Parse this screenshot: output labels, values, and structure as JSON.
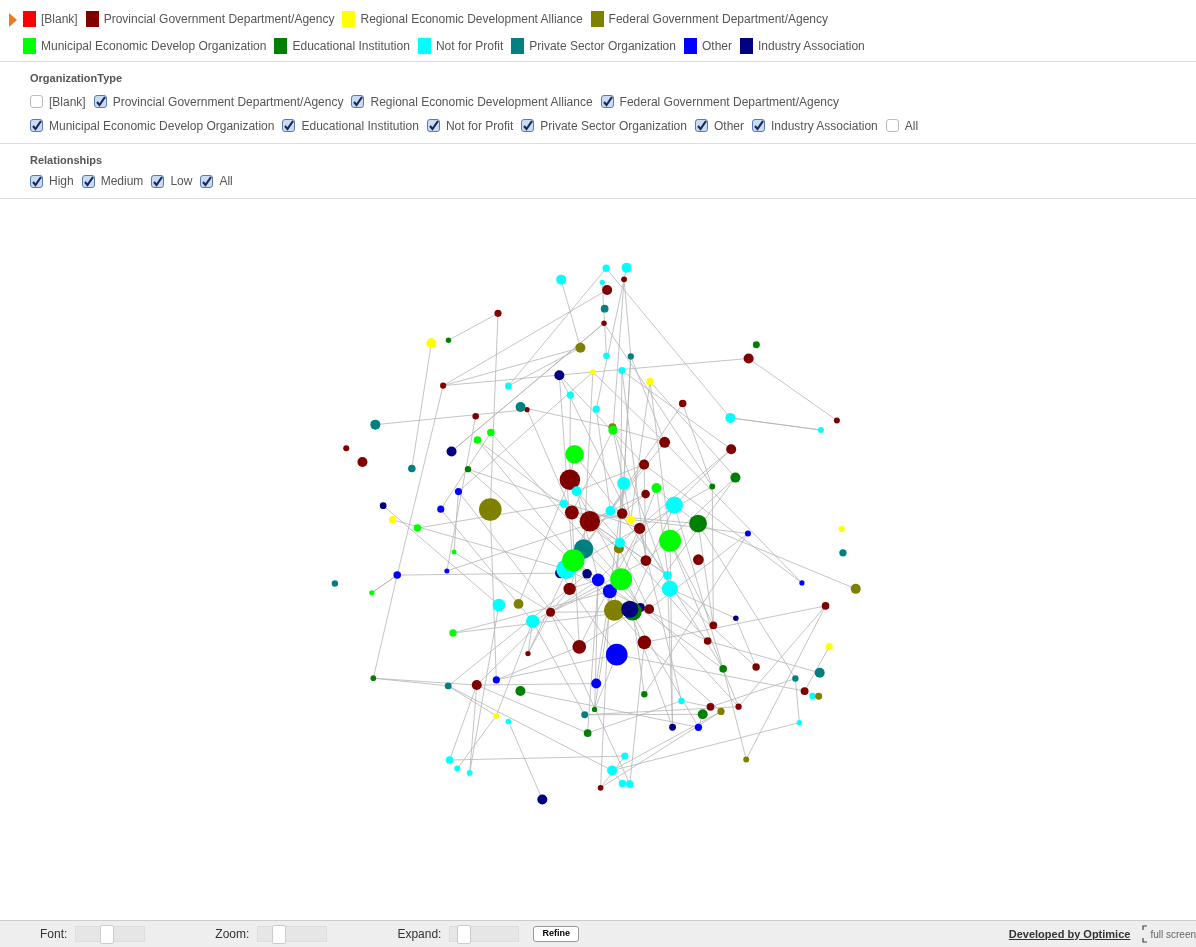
{
  "legend": [
    {
      "label": "[Blank]",
      "color": "#ff0000"
    },
    {
      "label": "Provincial Government Department/Agency",
      "color": "#800000"
    },
    {
      "label": "Regional Economic Development Alliance",
      "color": "#ffff00"
    },
    {
      "label": "Federal Government Department/Agency",
      "color": "#808000"
    },
    {
      "label": "Municipal Economic Develop Organization",
      "color": "#00ff00"
    },
    {
      "label": "Educational Institution",
      "color": "#008000"
    },
    {
      "label": "Not for Profit",
      "color": "#00ffff"
    },
    {
      "label": "Private Sector Organization",
      "color": "#008080"
    },
    {
      "label": "Other",
      "color": "#0000ff"
    },
    {
      "label": "Industry Association",
      "color": "#000080"
    }
  ],
  "organization_type": {
    "title": "OrganizationType",
    "options": [
      {
        "label": "[Blank]",
        "checked": false
      },
      {
        "label": "Provincial Government Department/Agency",
        "checked": true
      },
      {
        "label": "Regional Economic Development Alliance",
        "checked": true
      },
      {
        "label": "Federal Government Department/Agency",
        "checked": true
      },
      {
        "label": "Municipal Economic Develop Organization",
        "checked": true
      },
      {
        "label": "Educational Institution",
        "checked": true
      },
      {
        "label": "Not for Profit",
        "checked": true
      },
      {
        "label": "Private Sector Organization",
        "checked": true
      },
      {
        "label": "Other",
        "checked": true
      },
      {
        "label": "Industry Association",
        "checked": true
      },
      {
        "label": "All",
        "checked": false
      }
    ]
  },
  "relationships": {
    "title": "Relationships",
    "options": [
      {
        "label": "High",
        "checked": true
      },
      {
        "label": "Medium",
        "checked": true
      },
      {
        "label": "Low",
        "checked": true
      },
      {
        "label": "All",
        "checked": true
      }
    ]
  },
  "bottom_bar": {
    "sliders": [
      {
        "label": "Font:",
        "level": 0.45
      },
      {
        "label": "Zoom:",
        "level": 0.3
      },
      {
        "label": "Expand:",
        "level": 0.2
      }
    ],
    "refine_button": "Refine",
    "credit_link": "Developed by Optimice",
    "fullscreen": "full screen"
  }
}
